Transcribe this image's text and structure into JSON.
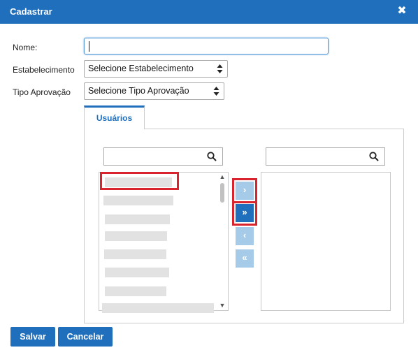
{
  "dialog": {
    "title": "Cadastrar",
    "close_icon": "close-icon"
  },
  "form": {
    "nome_label": "Nome:",
    "nome_value": "",
    "estabelecimento_label": "Estabelecimento",
    "estabelecimento_selected": "Selecione Estabelecimento",
    "tipo_label": "Tipo Aprovação",
    "tipo_selected": "Selecione Tipo Aprovação"
  },
  "tabs": [
    {
      "label": "Usuários",
      "active": true
    }
  ],
  "user_picker": {
    "available_search_value": "",
    "selected_search_value": "",
    "available_items_count_visible": 9,
    "selected_items_count": 0,
    "buttons": {
      "move_selected": "›",
      "move_all": "»",
      "remove_selected": "‹",
      "remove_all": "«"
    }
  },
  "footer": {
    "save_label": "Salvar",
    "cancel_label": "Cancelar"
  },
  "colors": {
    "primary": "#1f6fbd",
    "primary_light": "#a6cbe9",
    "highlight": "#d9232d"
  }
}
